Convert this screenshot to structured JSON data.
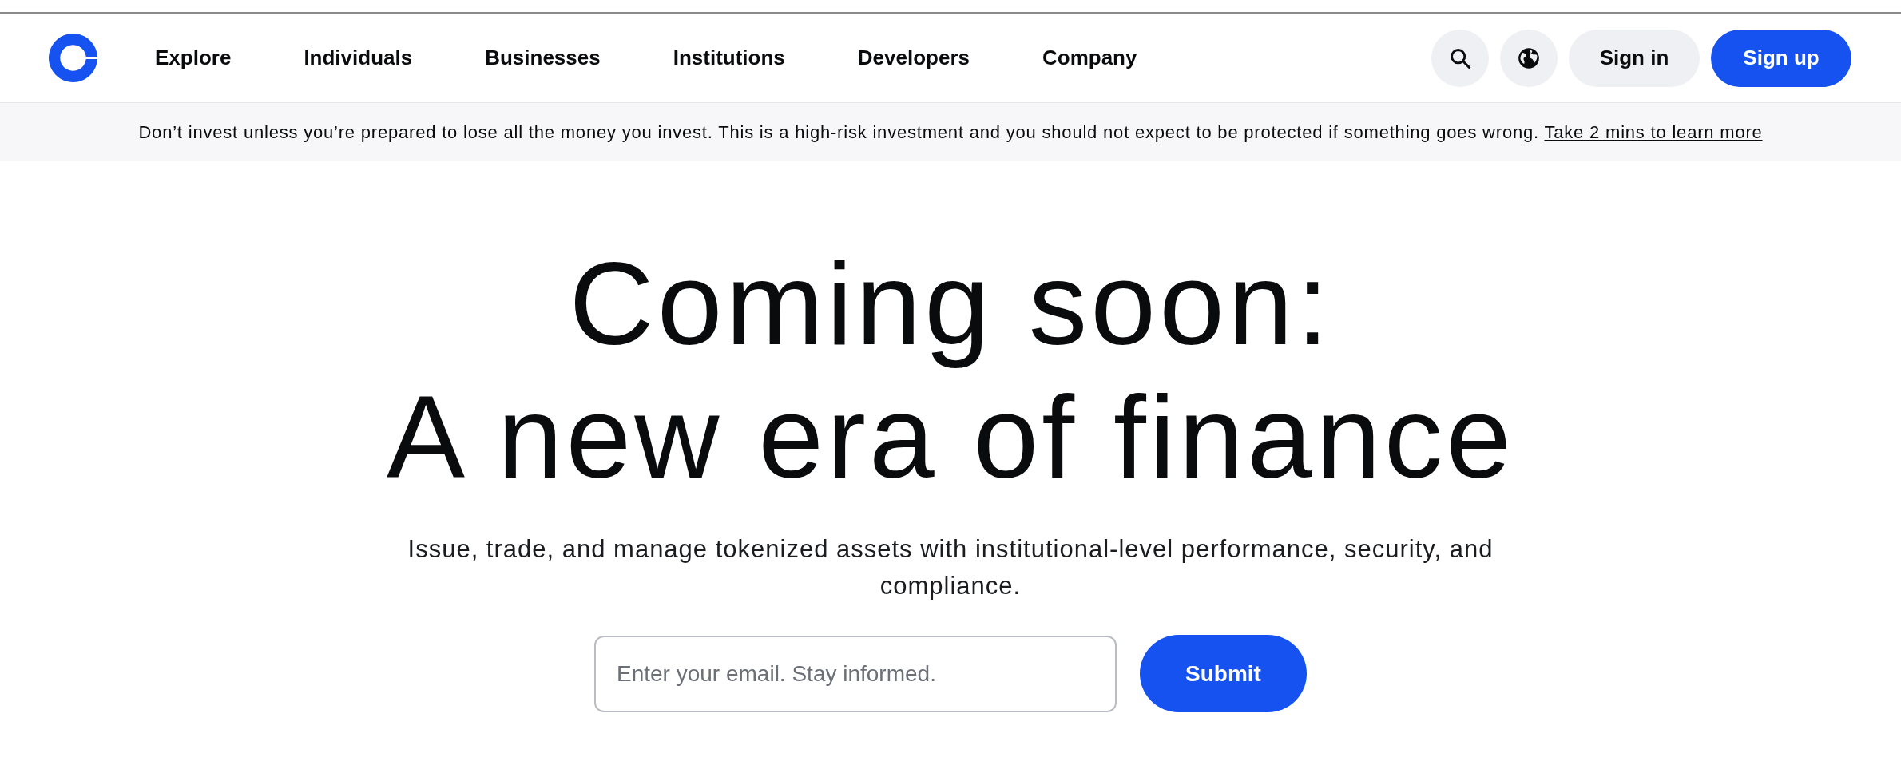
{
  "nav": {
    "links": [
      "Explore",
      "Individuals",
      "Businesses",
      "Institutions",
      "Developers",
      "Company"
    ],
    "sign_in": "Sign in",
    "sign_up": "Sign up"
  },
  "banner": {
    "text": "Don’t invest unless you’re prepared to lose all the money you invest. This is a high-risk investment and you should not expect to be protected if something goes wrong.",
    "link": "Take 2 mins to learn more"
  },
  "hero": {
    "title_lines": [
      "Coming soon:",
      "A new era of finance"
    ],
    "subtitle": "Issue, trade, and manage tokenized assets with institutional-level performance, security, and compliance.",
    "email": {
      "placeholder": "Enter your email. Stay informed."
    },
    "submit": "Submit"
  }
}
